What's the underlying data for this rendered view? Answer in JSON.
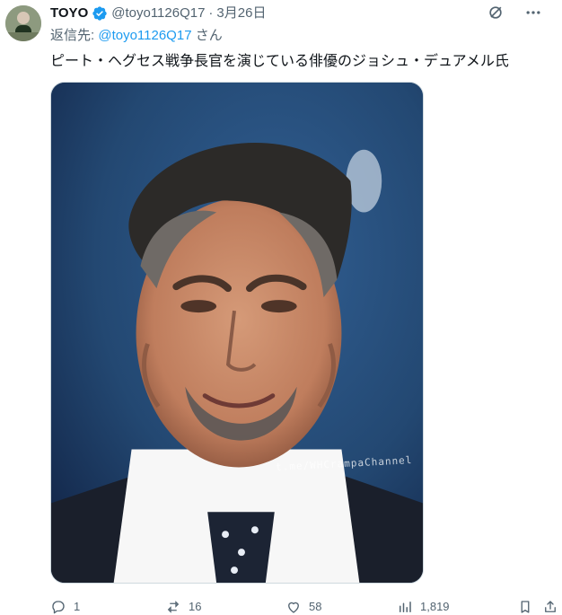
{
  "user": {
    "name": "TOYO",
    "handle": "@toyo1126Q17",
    "date": "3月26日"
  },
  "reply": {
    "prefix": "返信先:",
    "handle": "@toyo1126Q17",
    "suffix": "さん"
  },
  "tweet": {
    "text": "ピート・ヘグセス戦争長官を演じている俳優のジョシュ・デュアメル氏"
  },
  "media": {
    "watermark": "t.me/WHCrampaChannel"
  },
  "actions": {
    "replies": "1",
    "reposts": "16",
    "likes": "58",
    "views": "1,819"
  },
  "colors": {
    "accent": "#1d9bf0",
    "muted": "#536471"
  },
  "icons": {
    "verified": "verified-badge-icon",
    "grok": "grok-icon",
    "more": "more-icon"
  }
}
